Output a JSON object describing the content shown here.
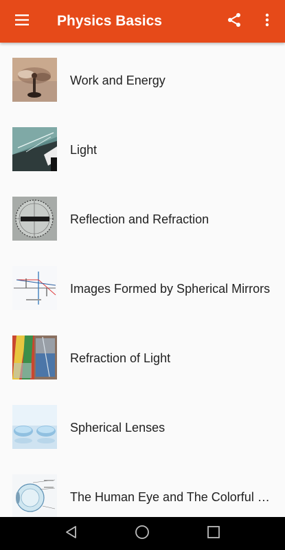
{
  "app_bar": {
    "title": "Physics Basics",
    "background_color": "#e64a19",
    "icons": [
      "menu-icon",
      "share-icon",
      "more-vert-icon"
    ]
  },
  "list": {
    "items": [
      {
        "label": "Work and Energy",
        "icon": "fan-thumbnail"
      },
      {
        "label": "Light",
        "icon": "glass-slab-light-thumbnail"
      },
      {
        "label": "Reflection and Refraction",
        "icon": "protractor-block-thumbnail"
      },
      {
        "label": "Images Formed by Spherical Mirrors",
        "icon": "ray-diagram-thumbnail"
      },
      {
        "label": "Refraction of Light",
        "icon": "glass-water-thumbnail"
      },
      {
        "label": "Spherical Lenses",
        "icon": "contact-lenses-thumbnail"
      },
      {
        "label": "The Human Eye and The Colorful World",
        "icon": "eye-diagram-thumbnail"
      }
    ]
  },
  "nav_bar": {
    "icons": [
      "back-icon",
      "home-icon",
      "recents-icon"
    ]
  }
}
